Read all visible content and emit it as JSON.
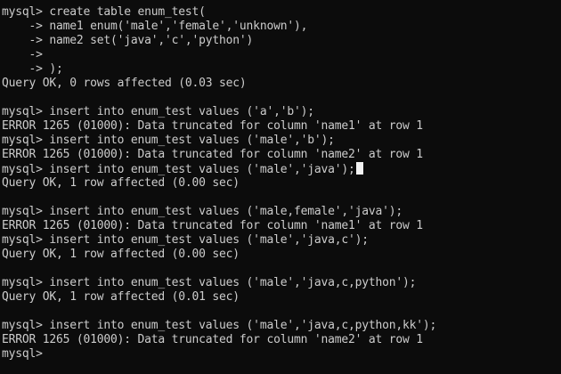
{
  "terminal": {
    "lines": [
      "mysql> create table enum_test(",
      "    -> name1 enum('male','female','unknown'),",
      "    -> name2 set('java','c','python')",
      "    ->",
      "    -> );",
      "Query OK, 0 rows affected (0.03 sec)",
      "",
      "mysql> insert into enum_test values ('a','b');",
      "ERROR 1265 (01000): Data truncated for column 'name1' at row 1",
      "mysql> insert into enum_test values ('male','b');",
      "ERROR 1265 (01000): Data truncated for column 'name2' at row 1",
      "mysql> insert into enum_test values ('male','java');",
      "Query OK, 1 row affected (0.00 sec)",
      "",
      "mysql> insert into enum_test values ('male,female','java');",
      "ERROR 1265 (01000): Data truncated for column 'name1' at row 1",
      "mysql> insert into enum_test values ('male','java,c');",
      "Query OK, 1 row affected (0.00 sec)",
      "",
      "mysql> insert into enum_test values ('male','java,c,python');",
      "Query OK, 1 row affected (0.01 sec)",
      "",
      "mysql> insert into enum_test values ('male','java,c,python,kk');",
      "ERROR 1265 (01000): Data truncated for column 'name2' at row 1",
      "mysql>"
    ],
    "cursor_line": 11
  },
  "colors": {
    "background": "#0c0c0c",
    "text": "#cccccc",
    "cursor": "#f2f2f2"
  }
}
